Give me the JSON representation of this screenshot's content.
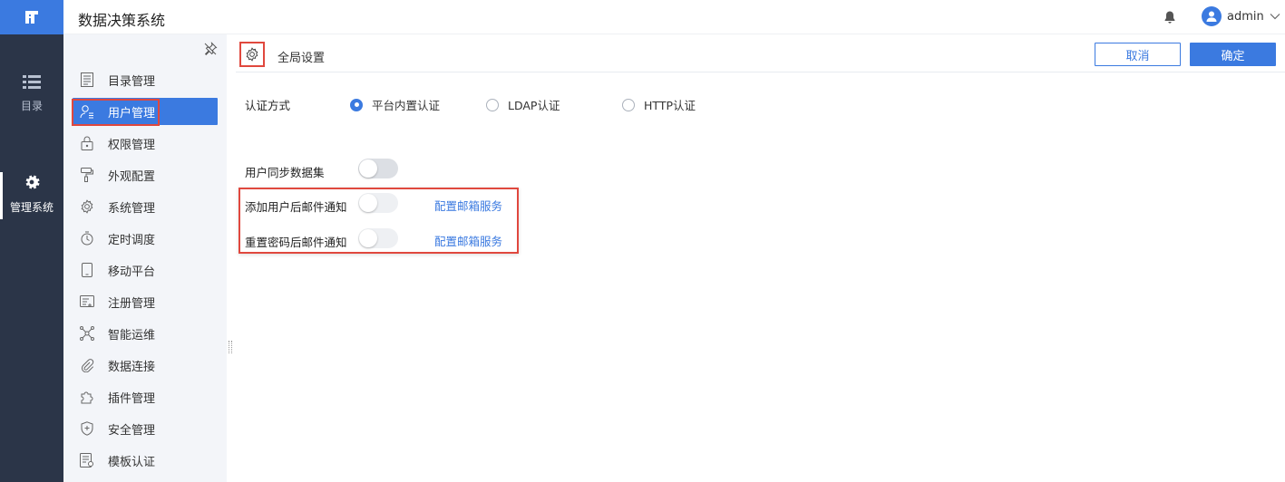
{
  "header": {
    "app_title": "数据决策系统",
    "username": "admin"
  },
  "rail": {
    "catalog_label": "目录",
    "admin_label": "管理系统"
  },
  "sidebar": {
    "items": [
      {
        "label": "目录管理",
        "icon": "catalog-list-icon"
      },
      {
        "label": "用户管理",
        "icon": "user-icon",
        "active": true
      },
      {
        "label": "权限管理",
        "icon": "lock-icon"
      },
      {
        "label": "外观配置",
        "icon": "paint-roller-icon"
      },
      {
        "label": "系统管理",
        "icon": "gear-icon"
      },
      {
        "label": "定时调度",
        "icon": "timer-icon"
      },
      {
        "label": "移动平台",
        "icon": "mobile-icon"
      },
      {
        "label": "注册管理",
        "icon": "register-icon"
      },
      {
        "label": "智能运维",
        "icon": "network-icon"
      },
      {
        "label": "数据连接",
        "icon": "link-clip-icon"
      },
      {
        "label": "插件管理",
        "icon": "puzzle-icon"
      },
      {
        "label": "安全管理",
        "icon": "shield-icon"
      },
      {
        "label": "模板认证",
        "icon": "template-icon"
      }
    ]
  },
  "main": {
    "section_title": "全局设置",
    "cancel_label": "取消",
    "ok_label": "确定",
    "auth": {
      "label": "认证方式",
      "options": [
        "平台内置认证",
        "LDAP认证",
        "HTTP认证"
      ],
      "selected": "平台内置认证"
    },
    "sync_label": "用户同步数据集",
    "sync_enabled": false,
    "mail_add_label": "添加用户后邮件通知",
    "mail_add_enabled": false,
    "mail_reset_label": "重置密码后邮件通知",
    "mail_reset_enabled": false,
    "config_mail_link": "配置邮箱服务"
  },
  "colors": {
    "accent": "#3b7ae0",
    "rail_bg": "#2b3548",
    "highlight": "#e0483e"
  }
}
